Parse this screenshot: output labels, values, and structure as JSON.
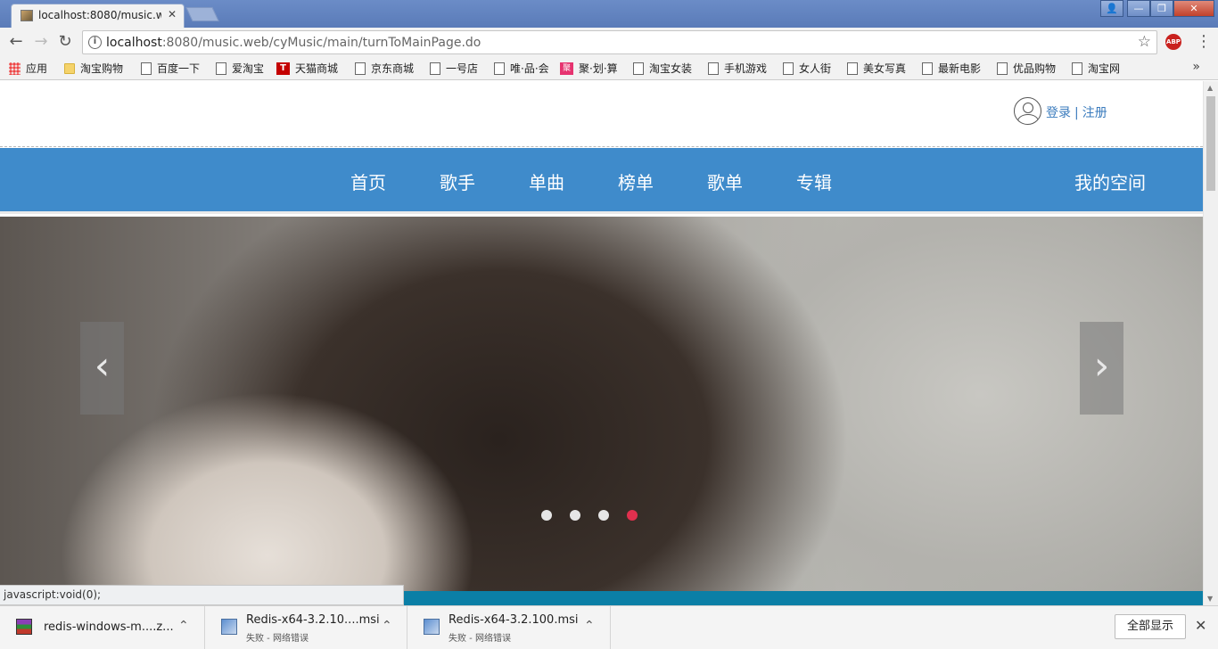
{
  "browser": {
    "tab_title": "localhost:8080/music.w",
    "url_host": "localhost",
    "url_rest": ":8080/music.web/cyMusic/main/turnToMainPage.do",
    "abp_label": "ABP",
    "bookmarks": [
      {
        "label": "应用",
        "icon": "apps-icon"
      },
      {
        "label": "淘宝购物",
        "icon": "folder-icon"
      },
      {
        "label": "百度一下",
        "icon": "page-icon"
      },
      {
        "label": "爱淘宝",
        "icon": "page-icon"
      },
      {
        "label": "天猫商城",
        "icon": "tmall-icon"
      },
      {
        "label": "京东商城",
        "icon": "page-icon"
      },
      {
        "label": "一号店",
        "icon": "page-icon"
      },
      {
        "label": "唯·品·会",
        "icon": "page-icon"
      },
      {
        "label": "聚·划·算",
        "icon": "juhuasuan-icon"
      },
      {
        "label": "淘宝女装",
        "icon": "page-icon"
      },
      {
        "label": "手机游戏",
        "icon": "page-icon"
      },
      {
        "label": "女人街",
        "icon": "page-icon"
      },
      {
        "label": "美女写真",
        "icon": "page-icon"
      },
      {
        "label": "最新电影",
        "icon": "page-icon"
      },
      {
        "label": "优品购物",
        "icon": "page-icon"
      },
      {
        "label": "淘宝网",
        "icon": "page-icon"
      }
    ],
    "status_text": "javascript:void(0);"
  },
  "header": {
    "login": "登录",
    "separator": "|",
    "register": "注册"
  },
  "nav": {
    "items": [
      "首页",
      "歌手",
      "单曲",
      "榜单",
      "歌单",
      "专辑"
    ],
    "my_space": "我的空间"
  },
  "carousel": {
    "slide_count": 4,
    "active_index": 3,
    "active_color": "#e0304e",
    "inactive_color": "#e6e6e6"
  },
  "downloads": {
    "items": [
      {
        "name": "redis-windows-m....z...",
        "status": "",
        "icon": "archive-icon"
      },
      {
        "name": "Redis-x64-3.2.10....msi",
        "status": "失败 - 网络错误",
        "icon": "msi-icon"
      },
      {
        "name": "Redis-x64-3.2.100.msi",
        "status": "失败 - 网络错误",
        "icon": "msi-icon"
      }
    ],
    "show_all": "全部显示"
  },
  "colors": {
    "nav_bg": "#3f8bcb",
    "link": "#3a7bbd",
    "strip": "#0b7fa6"
  }
}
